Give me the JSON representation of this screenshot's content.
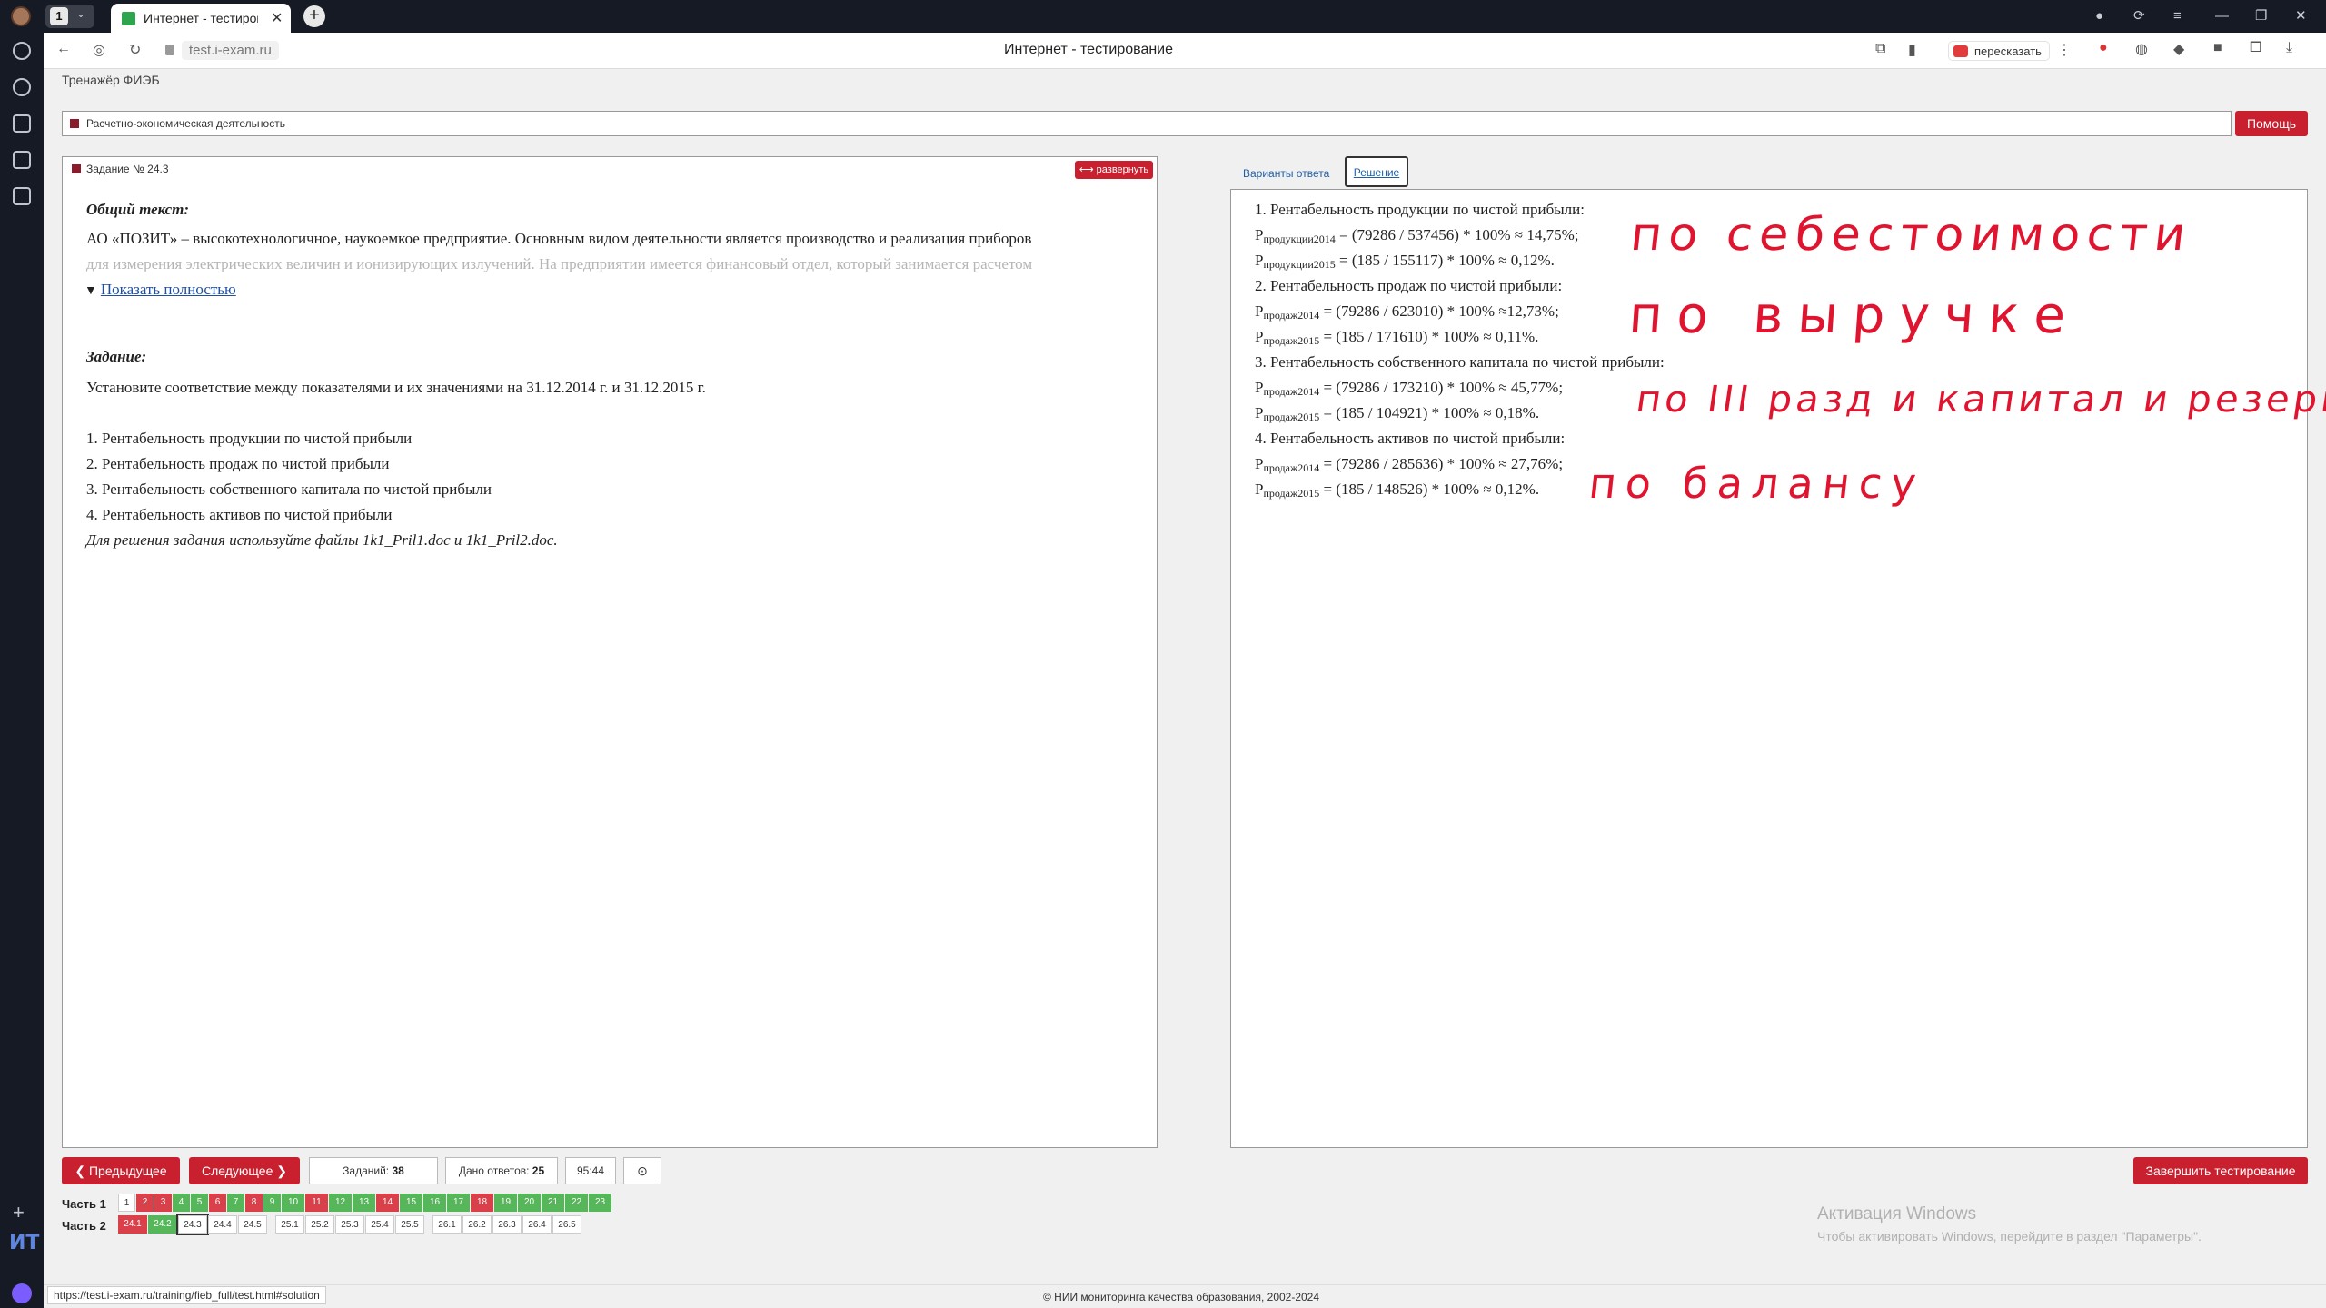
{
  "browser": {
    "tab_count": "1",
    "tab_title": "Интернет - тестирован",
    "url": "test.i-exam.ru",
    "page_title": "Интернет - тестирование",
    "retell_label": "пересказать",
    "status_url": "https://test.i-exam.ru/training/fieb_full/test.html#solution"
  },
  "app": {
    "title": "Тренажёр ФИЭБ",
    "section": "Расчетно-экономическая деятельность",
    "help_button": "Помощь"
  },
  "task": {
    "heading": "Задание № 24.3",
    "expand_button": "развернуть",
    "general_label": "Общий текст:",
    "general_line1": "АО «ПОЗИТ» – высокотехнологичное, наукоемкое предприятие. Основным видом деятельности является производство и реализация приборов",
    "general_line2": "для измерения электрических величин и ионизирующих излучений. На предприятии имеется финансовый отдел, который занимается расчетом",
    "show_more": "Показать полностью",
    "task_label": "Задание:",
    "instruction": "Установите соответствие между показателями и их значениями на 31.12.2014 г. и 31.12.2015 г.",
    "items": [
      "1. Рентабельность продукции по чистой прибыли",
      "2. Рентабельность продаж по чистой прибыли",
      "3. Рентабельность собственного капитала по чистой прибыли",
      "4. Рентабельность активов по чистой прибыли"
    ],
    "files_note": "Для решения задания используйте файлы 1k1_Pril1.doc и 1k1_Pril2.doc."
  },
  "tabs": {
    "variants": "Варианты ответа",
    "solution": "Решение"
  },
  "solution": [
    {
      "head": "1. Рентабельность продукции по чистой прибыли:"
    },
    {
      "p": "Р",
      "sub": "продукции2014",
      "rest": " = (79286 / 537456) * 100% ≈ 14,75%;"
    },
    {
      "p": "Р",
      "sub": "продукции2015",
      "rest": " =  (185 / 155117) * 100% ≈ 0,12%."
    },
    {
      "head": "2. Рентабельность продаж по чистой прибыли:"
    },
    {
      "p": "Р",
      "sub": "продаж2014",
      "rest": " = (79286 / 623010) * 100% ≈12,73%;"
    },
    {
      "p": "Р",
      "sub": "продаж2015",
      "rest": " = (185 / 171610) * 100% ≈ 0,11%."
    },
    {
      "head": "3. Рентабельность собственного капитала по чистой прибыли:"
    },
    {
      "p": "Р",
      "sub": "продаж2014",
      "rest": " = (79286 / 173210) * 100% ≈ 45,77%;"
    },
    {
      "p": "Р",
      "sub": "продаж2015",
      "rest": " = (185 / 104921) * 100% ≈ 0,18%."
    },
    {
      "head": "4. Рентабельность активов по чистой прибыли:"
    },
    {
      "p": "Р",
      "sub": "продаж2014",
      "rest": " = (79286 / 285636) * 100% ≈ 27,76%;"
    },
    {
      "p": "Р",
      "sub": "продаж2015",
      "rest": " = (185 / 148526) * 100% ≈ 0,12%."
    }
  ],
  "handwriting": {
    "note1": "по себестоимости",
    "note2": "по выручке",
    "note3": "по III разд и капитал и резервы",
    "note4": "по балансу",
    "color": "#e0142e"
  },
  "controls": {
    "prev": "Предыдущее",
    "next": "Следующее",
    "tasks_label": "Заданий:",
    "tasks_value": "38",
    "answered_label": "Дано ответов:",
    "answered_value": "25",
    "timer": "95:44",
    "finish": "Завершить тестирование"
  },
  "parts": {
    "part1_label": "Часть 1",
    "part2_label": "Часть 2",
    "part1": [
      {
        "n": "1",
        "s": "white"
      },
      {
        "n": "2",
        "s": "red"
      },
      {
        "n": "3",
        "s": "red"
      },
      {
        "n": "4",
        "s": "green"
      },
      {
        "n": "5",
        "s": "green"
      },
      {
        "n": "6",
        "s": "red"
      },
      {
        "n": "7",
        "s": "green"
      },
      {
        "n": "8",
        "s": "red"
      },
      {
        "n": "9",
        "s": "green"
      },
      {
        "n": "10",
        "s": "green"
      },
      {
        "n": "11",
        "s": "red"
      },
      {
        "n": "12",
        "s": "green"
      },
      {
        "n": "13",
        "s": "green"
      },
      {
        "n": "14",
        "s": "red"
      },
      {
        "n": "15",
        "s": "green"
      },
      {
        "n": "16",
        "s": "green"
      },
      {
        "n": "17",
        "s": "green"
      },
      {
        "n": "18",
        "s": "red"
      },
      {
        "n": "19",
        "s": "green"
      },
      {
        "n": "20",
        "s": "green"
      },
      {
        "n": "21",
        "s": "green"
      },
      {
        "n": "22",
        "s": "green"
      },
      {
        "n": "23",
        "s": "green"
      }
    ],
    "part2": [
      {
        "n": "24.1",
        "s": "red"
      },
      {
        "n": "24.2",
        "s": "green"
      },
      {
        "n": "24.3",
        "s": "white"
      },
      {
        "n": "24.4",
        "s": "white"
      },
      {
        "n": "24.5",
        "s": "white"
      },
      {
        "n": "25.1",
        "s": "white"
      },
      {
        "n": "25.2",
        "s": "white"
      },
      {
        "n": "25.3",
        "s": "white"
      },
      {
        "n": "25.4",
        "s": "white"
      },
      {
        "n": "25.5",
        "s": "white"
      },
      {
        "n": "26.1",
        "s": "white"
      },
      {
        "n": "26.2",
        "s": "white"
      },
      {
        "n": "26.3",
        "s": "white"
      },
      {
        "n": "26.4",
        "s": "white"
      },
      {
        "n": "26.5",
        "s": "white"
      }
    ]
  },
  "windows": {
    "activation_title": "Активация Windows",
    "activation_text": "Чтобы активировать Windows, перейдите в раздел \"Параметры\"."
  },
  "footer": {
    "copyright": "© НИИ мониторинга качества образования, 2002-2024"
  }
}
